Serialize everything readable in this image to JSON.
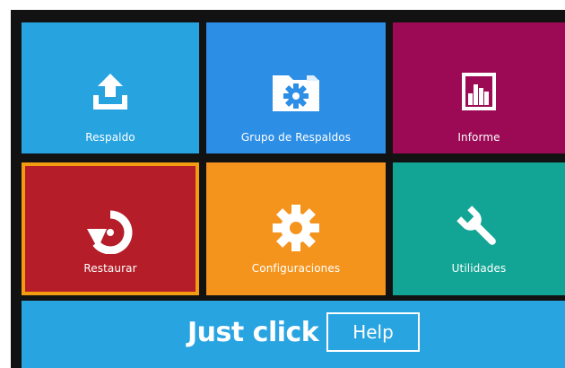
{
  "tiles": {
    "respaldo": {
      "label": "Respaldo",
      "icon": "upload-icon",
      "color": "#27a3e0"
    },
    "grupo": {
      "label": "Grupo de Respaldos",
      "icon": "folder-gear-icon",
      "color": "#2d8ee6"
    },
    "informe": {
      "label": "Informe",
      "icon": "bar-chart-icon",
      "color": "#9c0a55"
    },
    "restaurar": {
      "label": "Restaurar",
      "icon": "restore-icon",
      "color": "#b51e28",
      "selected": true,
      "highlight_color": "#f39c12"
    },
    "configuraciones": {
      "label": "Configuraciones",
      "icon": "gear-icon",
      "color": "#f5941d"
    },
    "utilidades": {
      "label": "Utilidades",
      "icon": "wrench-icon",
      "color": "#12a595"
    }
  },
  "footer": {
    "brand": "Just click",
    "help_label": "Help",
    "color": "#28a4e1"
  }
}
